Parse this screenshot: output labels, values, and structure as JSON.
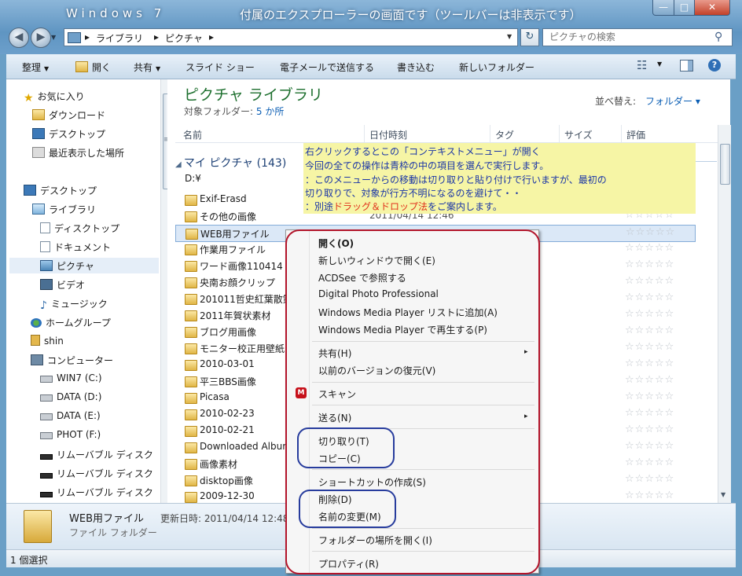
{
  "window": {
    "title": "Windows 7",
    "note": "付属のエクスプローラーの画面です（ツールバーは非表示です）",
    "min_glyph": "—",
    "max_glyph": "□",
    "close_glyph": "✕"
  },
  "nav": {
    "back": "◀",
    "forward": "▶",
    "dropdown": "▼"
  },
  "address": {
    "sep1": "▸",
    "crumb1": "ライブラリ",
    "sep2": "▸",
    "crumb2": "ピクチャ",
    "sep3": "▸",
    "dropdown": "▼",
    "refresh": "↻"
  },
  "search": {
    "placeholder": "ピクチャの検索",
    "icon": "⚲"
  },
  "toolbar": {
    "organize": "整理",
    "open": "開く",
    "share": "共有",
    "slideshow": "スライド ショー",
    "email": "電子メールで送信する",
    "burn": "書き込む",
    "new_folder": "新しいフォルダー",
    "caret": "▼",
    "views_icon": "☷",
    "help_icon": "?"
  },
  "sidebar": {
    "favorites": "お気に入り",
    "downloads": "ダウンロード",
    "desktop_fav": "デスクトップ",
    "recent": "最近表示した場所",
    "desktop": "デスクトップ",
    "libraries": "ライブラリ",
    "lib_desktop": "ディスクトップ",
    "documents": "ドキュメント",
    "pictures": "ピクチャ",
    "videos": "ビデオ",
    "music": "ミュージック",
    "homegroup": "ホームグループ",
    "user": "shin",
    "computer": "コンピューター",
    "drives": [
      "WIN7 (C:)",
      "DATA (D:)",
      "DATA (E:)",
      "PHOT (F:)",
      "リムーバブル ディスク",
      "リムーバブル ディスク",
      "リムーバブル ディスク"
    ],
    "scroll_marker": "≡"
  },
  "library": {
    "title": "ピクチャ ライブラリ",
    "target_label": "対象フォルダー:",
    "target_link": "5 か所",
    "arrange_label": "並べ替え:",
    "arrange_value": "フォルダー ▾"
  },
  "columns": {
    "name": "名前",
    "date": "日付時刻",
    "tag": "タグ",
    "size": "サイズ",
    "rating": "評価"
  },
  "group": {
    "header": "マイ ピクチャ (143)",
    "path": "D:¥"
  },
  "files": [
    {
      "name": "Exif-Erasd",
      "date": ""
    },
    {
      "name": "その他の画像",
      "date": "2011/04/14 12:46"
    },
    {
      "name": "WEB用ファイル",
      "date": ""
    },
    {
      "name": "作業用ファイル",
      "date": ""
    },
    {
      "name": "ワード画像110414",
      "date": ""
    },
    {
      "name": "央南お顔クリップ",
      "date": ""
    },
    {
      "name": "201011哲史紅葉散策",
      "date": ""
    },
    {
      "name": "2011年賀状素材",
      "date": ""
    },
    {
      "name": "ブログ用画像",
      "date": ""
    },
    {
      "name": "モニター校正用壁紙",
      "date": ""
    },
    {
      "name": "2010-03-01",
      "date": ""
    },
    {
      "name": "平三BBS画像",
      "date": ""
    },
    {
      "name": "Picasa",
      "date": ""
    },
    {
      "name": "2010-02-23",
      "date": ""
    },
    {
      "name": "2010-02-21",
      "date": ""
    },
    {
      "name": "Downloaded Albums",
      "date": ""
    },
    {
      "name": "画像素材",
      "date": ""
    },
    {
      "name": "disktop画像",
      "date": ""
    },
    {
      "name": "2009-12-30",
      "date": ""
    }
  ],
  "stars": "☆☆☆☆☆",
  "annotation": {
    "line1": "右クリックするとこの「コンテキストメニュー」が開く",
    "line2": "今回の全ての操作は青枠の中の項目を選んで実行します。",
    "line3": "：このメニューからの移動は切り取りと貼り付けで行いますが、最初の",
    "line4": "切り取りで、対象が行方不明になるのを避けて・・",
    "line5a": "：別途",
    "line5b": "ドラッグ＆ドロップ法",
    "line5c": "をご案内します。"
  },
  "context_menu": {
    "open": "開く(O)",
    "open_new_window": "新しいウィンドウで開く(E)",
    "acdsee": "ACDSee で参照する",
    "digital_photo": "Digital Photo Professional",
    "wmp_add": "Windows Media Player リストに追加(A)",
    "wmp_play": "Windows Media Player で再生する(P)",
    "share": "共有(H)",
    "restore": "以前のバージョンの復元(V)",
    "scan": "スキャン",
    "scan_icon": "M",
    "send_to": "送る(N)",
    "cut": "切り取り(T)",
    "copy": "コピー(C)",
    "shortcut": "ショートカットの作成(S)",
    "delete": "削除(D)",
    "rename": "名前の変更(M)",
    "open_location": "フォルダーの場所を開く(I)",
    "properties": "プロパティ(R)",
    "submenu_arrow": "▸"
  },
  "details": {
    "name": "WEB用ファイル",
    "modified": "更新日時: 2011/04/14 12:48",
    "type": "ファイル フォルダー"
  },
  "status": {
    "text": "1 個選択"
  }
}
